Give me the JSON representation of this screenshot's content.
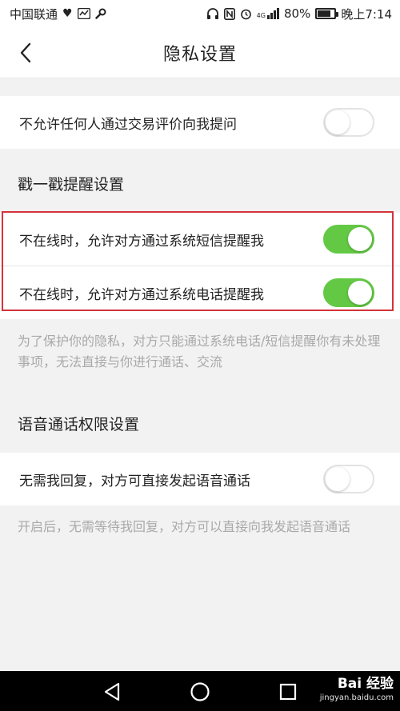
{
  "status_bar": {
    "carrier": "中国联通",
    "battery": "80%",
    "time": "晚上7:14",
    "network": "4G",
    "battery_level": 0.8,
    "icons": [
      "heart-icon",
      "activity-icon",
      "wrench-icon",
      "headset-icon",
      "nfc-icon",
      "alarm-icon",
      "signal-icon",
      "battery-icon"
    ]
  },
  "header": {
    "title": "隐私设置",
    "back_icon": "chevron-left-icon"
  },
  "settings": {
    "no_question_via_review": {
      "label": "不允许任何人通过交易评价向我提问",
      "enabled": false
    },
    "poke_section_title": "戳一戳提醒设置",
    "sms_remind": {
      "label": "不在线时，允许对方通过系统短信提醒我",
      "enabled": true
    },
    "call_remind": {
      "label": "不在线时，允许对方通过系统电话提醒我",
      "enabled": true
    },
    "poke_hint": "为了保护你的隐私，对方只能通过系统电话/短信提醒你有未处理事项，无法直接与你进行通话、交流",
    "voice_section_title": "语音通话权限设置",
    "direct_voice_call": {
      "label": "无需我回复，对方可直接发起语音通话",
      "enabled": false
    },
    "voice_hint": "开启后，无需等待我回复，对方可以直接向我发起语音通话"
  },
  "colors": {
    "toggle_on": "#63c944",
    "highlight_box": "#d3333a",
    "hint_text": "#a9a9a9"
  },
  "nav_bar": {
    "back_icon": "triangle-back-icon",
    "home_icon": "circle-home-icon",
    "recents_icon": "square-recents-icon"
  },
  "watermark": {
    "brand": "Bai 经验",
    "url": "jingyan.baidu.com"
  }
}
